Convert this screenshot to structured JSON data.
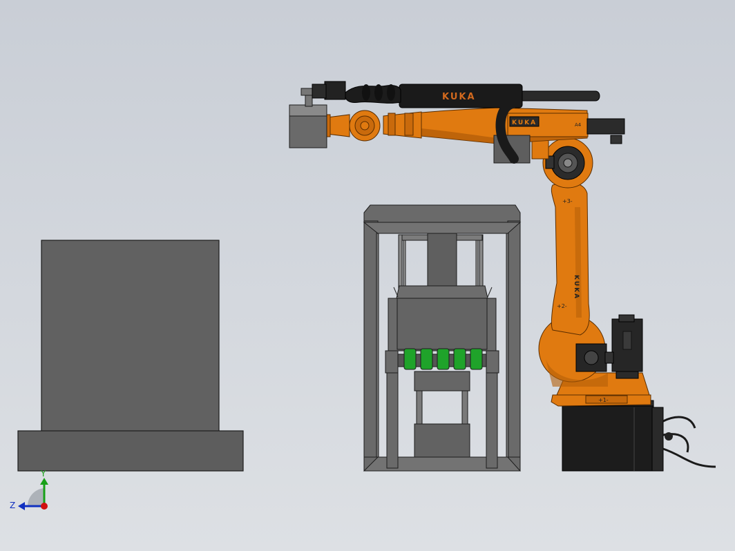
{
  "colors": {
    "background_top": "#c9ced6",
    "background_bottom": "#dde0e4",
    "robot_orange": "#e07a10",
    "robot_orange_dark": "#9a4d05",
    "gray_block": "#5f5f5f",
    "frame_gray": "#6d6d6d",
    "green_rollers": "#1fa32a",
    "cable_black": "#1a1a1a"
  },
  "robot": {
    "brand_upper": "KUKA",
    "brand_joint": "KUKA",
    "brand_arm": "KUKA",
    "axis_a4": "A4",
    "axis_a3": "+3-",
    "axis_a2": "+2-",
    "axis_a1": "+1-"
  },
  "triad": {
    "y_label": "Y",
    "z_label": "Z",
    "x_color": "#d01010",
    "y_color": "#18a018",
    "z_color": "#1030c0"
  },
  "icons": {
    "triad": "coordinate-triad-icon"
  }
}
